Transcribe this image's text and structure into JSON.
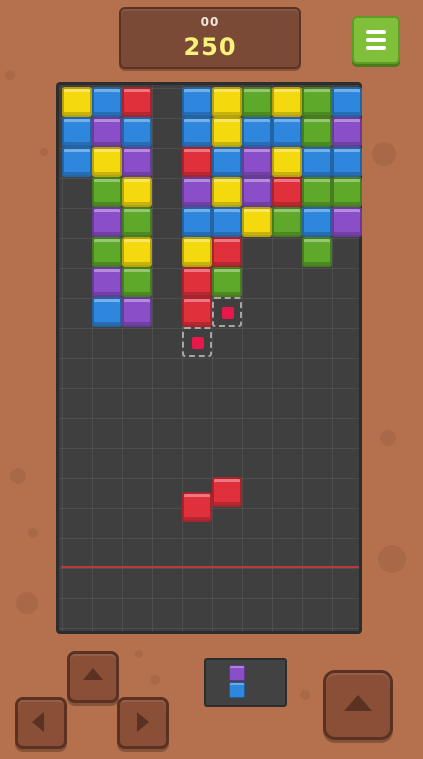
{
  "header": {
    "best_score": "00",
    "score": "250"
  },
  "colors": {
    "background": "#b5714e",
    "board": "#3f3f3f",
    "yellow": "#f4d90f",
    "blue": "#2f86dd",
    "red": "#e0303c",
    "purple": "#8a4fc8",
    "green": "#5ea82a",
    "limit_line": "#b83a3a",
    "ghost_dot": "#e8194a"
  },
  "board": {
    "columns": 10,
    "rows": 18,
    "settled_blocks": [
      {
        "col": 0,
        "row": 0,
        "color": "yellow"
      },
      {
        "col": 1,
        "row": 0,
        "color": "blue"
      },
      {
        "col": 2,
        "row": 0,
        "color": "red"
      },
      {
        "col": 4,
        "row": 0,
        "color": "blue"
      },
      {
        "col": 5,
        "row": 0,
        "color": "yellow"
      },
      {
        "col": 6,
        "row": 0,
        "color": "green"
      },
      {
        "col": 7,
        "row": 0,
        "color": "yellow"
      },
      {
        "col": 8,
        "row": 0,
        "color": "green"
      },
      {
        "col": 9,
        "row": 0,
        "color": "blue"
      },
      {
        "col": 0,
        "row": 1,
        "color": "blue"
      },
      {
        "col": 1,
        "row": 1,
        "color": "purple"
      },
      {
        "col": 2,
        "row": 1,
        "color": "blue"
      },
      {
        "col": 4,
        "row": 1,
        "color": "blue"
      },
      {
        "col": 5,
        "row": 1,
        "color": "yellow"
      },
      {
        "col": 6,
        "row": 1,
        "color": "blue"
      },
      {
        "col": 7,
        "row": 1,
        "color": "blue"
      },
      {
        "col": 8,
        "row": 1,
        "color": "green"
      },
      {
        "col": 9,
        "row": 1,
        "color": "purple"
      },
      {
        "col": 0,
        "row": 2,
        "color": "blue"
      },
      {
        "col": 1,
        "row": 2,
        "color": "yellow"
      },
      {
        "col": 2,
        "row": 2,
        "color": "purple"
      },
      {
        "col": 4,
        "row": 2,
        "color": "red"
      },
      {
        "col": 5,
        "row": 2,
        "color": "blue"
      },
      {
        "col": 6,
        "row": 2,
        "color": "purple"
      },
      {
        "col": 7,
        "row": 2,
        "color": "yellow"
      },
      {
        "col": 8,
        "row": 2,
        "color": "blue"
      },
      {
        "col": 9,
        "row": 2,
        "color": "blue"
      },
      {
        "col": 1,
        "row": 3,
        "color": "green"
      },
      {
        "col": 2,
        "row": 3,
        "color": "yellow"
      },
      {
        "col": 4,
        "row": 3,
        "color": "purple"
      },
      {
        "col": 5,
        "row": 3,
        "color": "yellow"
      },
      {
        "col": 6,
        "row": 3,
        "color": "purple"
      },
      {
        "col": 7,
        "row": 3,
        "color": "red"
      },
      {
        "col": 8,
        "row": 3,
        "color": "green"
      },
      {
        "col": 9,
        "row": 3,
        "color": "green"
      },
      {
        "col": 1,
        "row": 4,
        "color": "purple"
      },
      {
        "col": 2,
        "row": 4,
        "color": "green"
      },
      {
        "col": 4,
        "row": 4,
        "color": "blue"
      },
      {
        "col": 5,
        "row": 4,
        "color": "blue"
      },
      {
        "col": 6,
        "row": 4,
        "color": "yellow"
      },
      {
        "col": 7,
        "row": 4,
        "color": "green"
      },
      {
        "col": 8,
        "row": 4,
        "color": "blue"
      },
      {
        "col": 9,
        "row": 4,
        "color": "purple"
      },
      {
        "col": 1,
        "row": 5,
        "color": "green"
      },
      {
        "col": 2,
        "row": 5,
        "color": "yellow"
      },
      {
        "col": 4,
        "row": 5,
        "color": "yellow"
      },
      {
        "col": 5,
        "row": 5,
        "color": "red"
      },
      {
        "col": 8,
        "row": 5,
        "color": "green"
      },
      {
        "col": 1,
        "row": 6,
        "color": "purple"
      },
      {
        "col": 2,
        "row": 6,
        "color": "green"
      },
      {
        "col": 4,
        "row": 6,
        "color": "red"
      },
      {
        "col": 5,
        "row": 6,
        "color": "green"
      },
      {
        "col": 1,
        "row": 7,
        "color": "blue"
      },
      {
        "col": 2,
        "row": 7,
        "color": "purple"
      },
      {
        "col": 4,
        "row": 7,
        "color": "red"
      }
    ],
    "ghost_cells": [
      {
        "col": 5,
        "row": 7
      },
      {
        "col": 4,
        "row": 8
      }
    ],
    "falling_blocks": [
      {
        "col": 4,
        "row": 13.5,
        "color": "red"
      },
      {
        "col": 5,
        "row": 13.0,
        "color": "red"
      }
    ]
  },
  "next_piece": {
    "top_color": "purple",
    "bottom_color": "blue"
  },
  "controls": {
    "up_icon": "triangle-up",
    "left_icon": "triangle-left",
    "right_icon": "triangle-right",
    "drop_icon": "triangle-up-large"
  }
}
